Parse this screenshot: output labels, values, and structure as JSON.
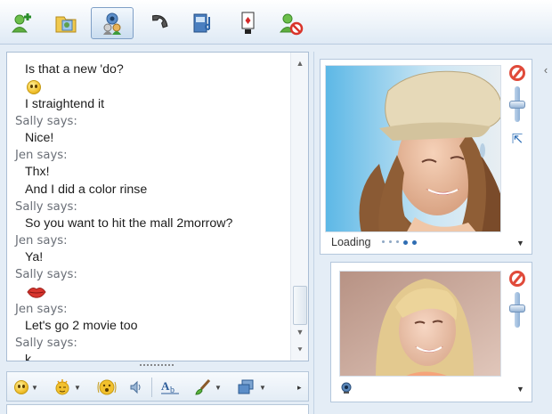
{
  "toolbar": {
    "buttons": [
      {
        "icon": "add-contact-icon"
      },
      {
        "icon": "share-files-icon"
      },
      {
        "icon": "video-call-icon",
        "active": true
      },
      {
        "icon": "phone-icon"
      },
      {
        "icon": "activities-icon"
      },
      {
        "icon": "games-icon"
      },
      {
        "icon": "block-contact-icon"
      }
    ]
  },
  "conversation": {
    "messages": [
      {
        "type": "text",
        "value": "Is that a new 'do?"
      },
      {
        "type": "emoticon",
        "icon": "smiley-icon"
      },
      {
        "type": "text",
        "value": "I straightend it"
      },
      {
        "type": "sender",
        "value": "Sally says:"
      },
      {
        "type": "text",
        "value": "Nice!"
      },
      {
        "type": "sender",
        "value": "Jen says:"
      },
      {
        "type": "text",
        "value": "Thx!"
      },
      {
        "type": "text",
        "value": "And I did a color rinse"
      },
      {
        "type": "sender",
        "value": "Sally says:"
      },
      {
        "type": "text",
        "value": "So you want to hit the mall 2morrow?"
      },
      {
        "type": "sender",
        "value": "Jen says:"
      },
      {
        "type": "text",
        "value": "Ya!"
      },
      {
        "type": "sender",
        "value": "Sally says:"
      },
      {
        "type": "emoticon",
        "icon": "lips-icon"
      },
      {
        "type": "sender",
        "value": "Jen says:"
      },
      {
        "type": "text",
        "value": "Let's go 2 movie too"
      },
      {
        "type": "sender",
        "value": "Sally says:"
      },
      {
        "type": "text",
        "value": "k"
      }
    ]
  },
  "format_bar": {
    "items": [
      "emoticons-icon",
      "winks-icon",
      "nudge-icon",
      "voice-clip-icon",
      "font-icon",
      "background-icon",
      "send-files-icon",
      "more-icon"
    ]
  },
  "video": {
    "remote": {
      "status": "Loading"
    },
    "local": {}
  },
  "colors": {
    "accent": "#2f6db3",
    "block": "#e04a3a",
    "sender_text": "#6a6f77"
  }
}
